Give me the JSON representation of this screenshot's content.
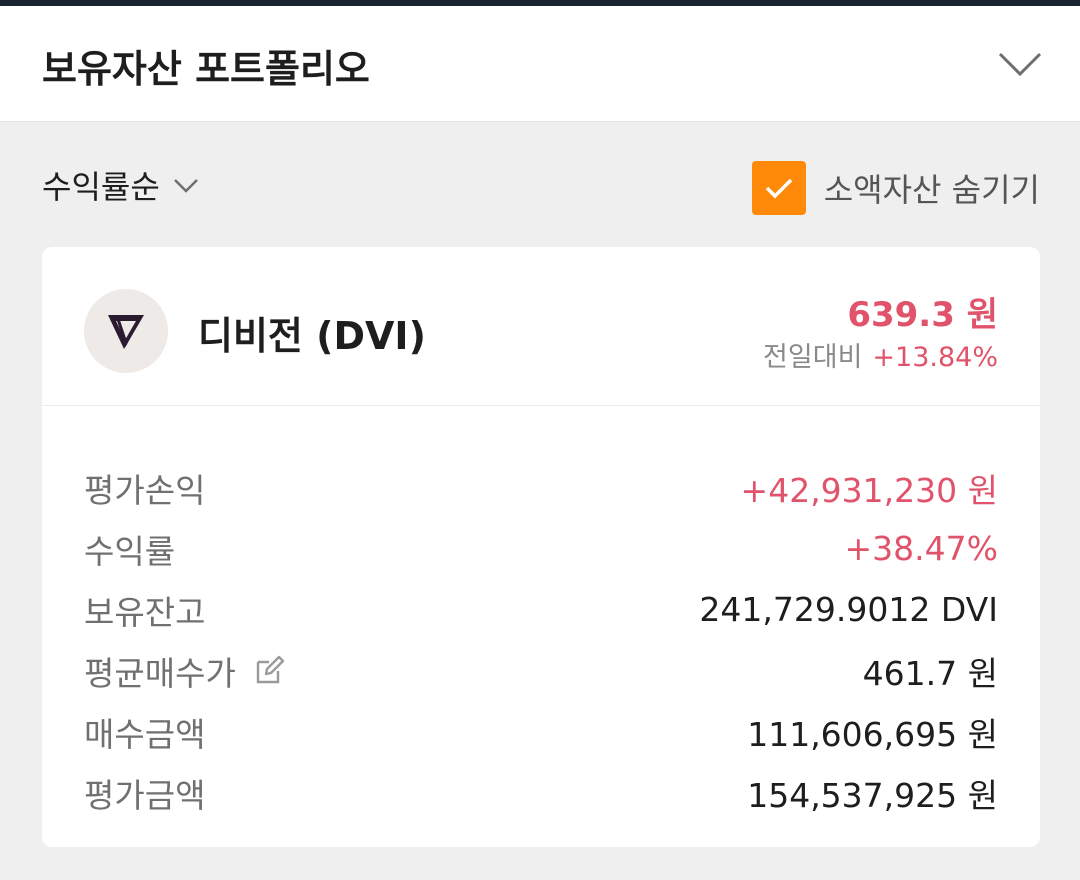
{
  "header": {
    "title": "보유자산 포트폴리오"
  },
  "sort": {
    "label": "수익률순"
  },
  "hide_small": {
    "label": "소액자산 숨기기",
    "checked": true
  },
  "asset": {
    "name": "디비전 (DVI)",
    "price": "639.3 원",
    "change_label": "전일대비",
    "change_value": "+13.84%"
  },
  "details": [
    {
      "label": "평가손익",
      "value": "+42,931,230 원"
    },
    {
      "label": "수익률",
      "value": "+38.47%"
    },
    {
      "label": "보유잔고",
      "value": "241,729.9012 DVI"
    },
    {
      "label": "평균매수가",
      "value": "461.7 원"
    },
    {
      "label": "매수금액",
      "value": "111,606,695 원"
    },
    {
      "label": "평가금액",
      "value": "154,537,925 원"
    }
  ],
  "colors": {
    "accent_orange": "#ff8a0a",
    "positive_red": "#e0536a",
    "top_strip": "#1b2230"
  },
  "icons": [
    "chevron-down-icon",
    "checkmark-icon",
    "division-logo-icon",
    "edit-icon"
  ]
}
